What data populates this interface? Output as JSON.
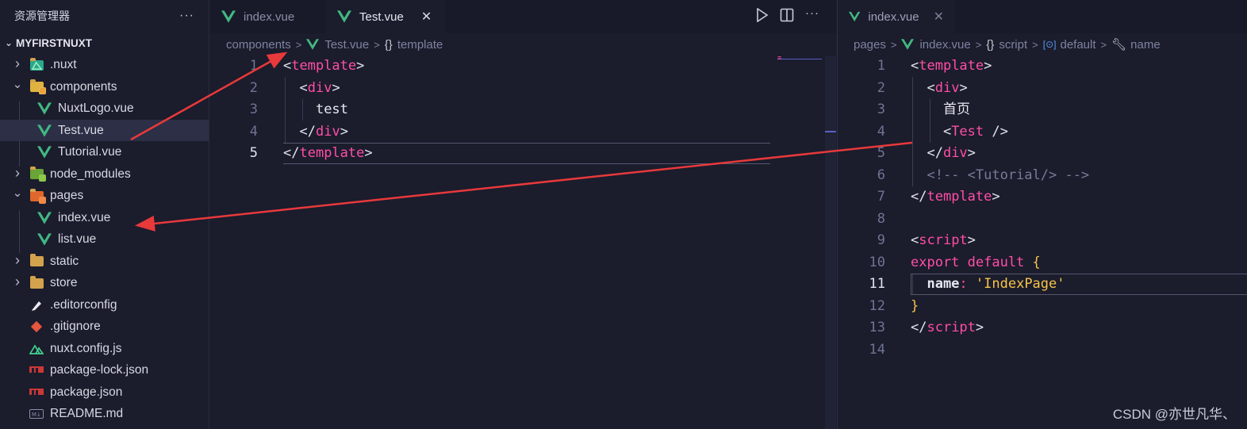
{
  "sidebar": {
    "title": "资源管理器",
    "more": "···",
    "project": "MYFIRSTNUXT",
    "items": [
      {
        "label": ".nuxt",
        "icon": "nuxt-folder-icon",
        "type": "folder",
        "expanded": false
      },
      {
        "label": "components",
        "icon": "components-folder-icon",
        "type": "folder",
        "expanded": true
      },
      {
        "label": "NuxtLogo.vue",
        "icon": "vue-icon",
        "type": "file"
      },
      {
        "label": "Test.vue",
        "icon": "vue-icon",
        "type": "file",
        "selected": true
      },
      {
        "label": "Tutorial.vue",
        "icon": "vue-icon",
        "type": "file"
      },
      {
        "label": "node_modules",
        "icon": "node-folder-icon",
        "type": "folder",
        "expanded": false
      },
      {
        "label": "pages",
        "icon": "pages-folder-icon",
        "type": "folder",
        "expanded": true
      },
      {
        "label": "index.vue",
        "icon": "vue-icon",
        "type": "file"
      },
      {
        "label": "list.vue",
        "icon": "vue-icon",
        "type": "file"
      },
      {
        "label": "static",
        "icon": "folder-icon",
        "type": "folder",
        "expanded": false
      },
      {
        "label": "store",
        "icon": "folder-icon",
        "type": "folder",
        "expanded": false
      },
      {
        "label": ".editorconfig",
        "icon": "editorconfig-icon",
        "type": "file"
      },
      {
        "label": ".gitignore",
        "icon": "git-icon",
        "type": "file"
      },
      {
        "label": "nuxt.config.js",
        "icon": "nuxt-icon",
        "type": "file"
      },
      {
        "label": "package-lock.json",
        "icon": "npm-icon",
        "type": "file"
      },
      {
        "label": "package.json",
        "icon": "npm-icon",
        "type": "file"
      },
      {
        "label": "README.md",
        "icon": "markdown-icon",
        "type": "file"
      }
    ]
  },
  "left_editor": {
    "tabs": [
      {
        "label": "index.vue",
        "active": false
      },
      {
        "label": "Test.vue",
        "active": true,
        "close": "✕"
      }
    ],
    "breadcrumb": [
      "components",
      "Test.vue",
      "template"
    ],
    "line_numbers": [
      "1",
      "2",
      "3",
      "4",
      "5"
    ],
    "current_line": "5",
    "lines": [
      {
        "indent": "",
        "open": "<",
        "tag": "template",
        "close": ">",
        "text": ""
      },
      {
        "indent": "  ",
        "open": "<",
        "tag": "div",
        "close": ">",
        "text": ""
      },
      {
        "indent": "    ",
        "open": "",
        "tag": "",
        "close": "",
        "text": "test"
      },
      {
        "indent": "  ",
        "open": "</",
        "tag": "div",
        "close": ">",
        "text": ""
      },
      {
        "indent": "",
        "open": "</",
        "tag": "template",
        "close": ">",
        "text": ""
      }
    ]
  },
  "right_editor": {
    "tabs": [
      {
        "label": "index.vue",
        "active": true,
        "close": "✕"
      }
    ],
    "breadcrumb": [
      "pages",
      "index.vue",
      "script",
      "default",
      "name"
    ],
    "line_numbers": [
      "1",
      "2",
      "3",
      "4",
      "5",
      "6",
      "7",
      "8",
      "9",
      "10",
      "11",
      "12",
      "13",
      "14"
    ],
    "current_line": "11",
    "code": {
      "l1": [
        "<",
        "template",
        ">"
      ],
      "l2": [
        "  <",
        "div",
        ">"
      ],
      "l3": "    首页",
      "l4": [
        "    <",
        "Test",
        " />"
      ],
      "l5": [
        "  </",
        "div",
        ">"
      ],
      "l6": "  <!-- <Tutorial/> -->",
      "l7": [
        "</",
        "template",
        ">"
      ],
      "l9": [
        "<",
        "script",
        ">"
      ],
      "l10": [
        "export default ",
        "{"
      ],
      "l11": [
        "  name",
        ": ",
        "'IndexPage'"
      ],
      "l12": "}",
      "l13": [
        "</",
        "script",
        ">"
      ]
    }
  },
  "watermark": "CSDN @亦世凡华、",
  "colors": {
    "background": "#1b1c2c",
    "tag": "#ff4fa6",
    "string": "#f6c34a",
    "vue_green": "#41b883",
    "folder": "#d3a24c",
    "arrow": "#e8393b"
  }
}
